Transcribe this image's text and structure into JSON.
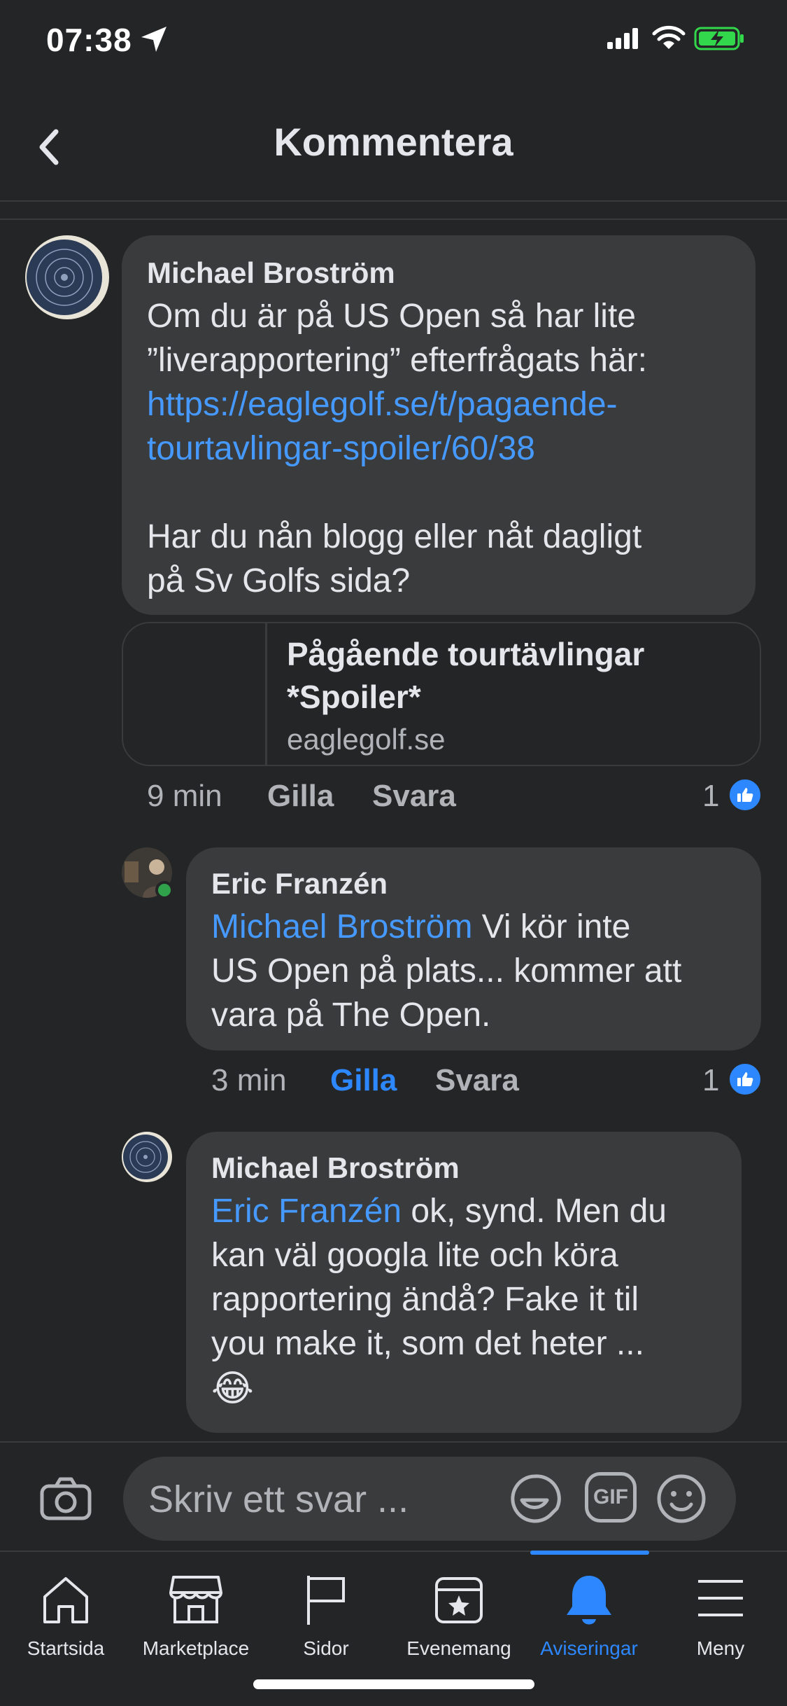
{
  "status_bar": {
    "time": "07:38"
  },
  "header": {
    "title": "Kommentera"
  },
  "comments": [
    {
      "author": "Michael Broström",
      "text_line1": "Om du är på US Open så har lite",
      "text_line2": "”liverapportering” efterfrågats här:",
      "link_line1": "https://eaglegolf.se/t/pagaende-",
      "link_line2": "tourtavlingar-spoiler/60/38",
      "text_line3": "Har du nån blogg eller nåt dagligt",
      "text_line4": "på Sv Golfs sida?",
      "preview": {
        "title_line1": "Pågående tourtävlingar",
        "title_line2": "*Spoiler*",
        "domain": "eaglegolf.se"
      },
      "time": "9 min",
      "like_label": "Gilla",
      "reply_label": "Svara",
      "likes": "1"
    },
    {
      "author": "Eric Franzén",
      "mention": "Michael Broström",
      "text_line1_rest": " Vi kör inte",
      "text_line2": "US Open på plats... kommer att",
      "text_line3": "vara på The Open.",
      "time": "3 min",
      "like_label": "Gilla",
      "reply_label": "Svara",
      "likes": "1"
    },
    {
      "author": "Michael Broström",
      "mention": "Eric Franzén",
      "text_line1_rest": " ok, synd. Men du",
      "text_line2": "kan väl googla lite och köra",
      "text_line3": "rapportering ändå? Fake it til",
      "text_line4": "you make it, som det heter ...",
      "emoji": "😂"
    }
  ],
  "composer": {
    "placeholder": "Skriv ett svar ...",
    "gif_label": "GIF"
  },
  "tabs": [
    {
      "label": "Startsida",
      "icon": "home-icon"
    },
    {
      "label": "Marketplace",
      "icon": "marketplace-icon"
    },
    {
      "label": "Sidor",
      "icon": "flag-icon"
    },
    {
      "label": "Evenemang",
      "icon": "calendar-star-icon"
    },
    {
      "label": "Aviseringar",
      "icon": "bell-icon",
      "active": true
    },
    {
      "label": "Meny",
      "icon": "menu-icon"
    }
  ],
  "colors": {
    "background": "#242526",
    "bubble": "#3a3b3c",
    "accent": "#2d88ff",
    "link": "#4599ff"
  }
}
